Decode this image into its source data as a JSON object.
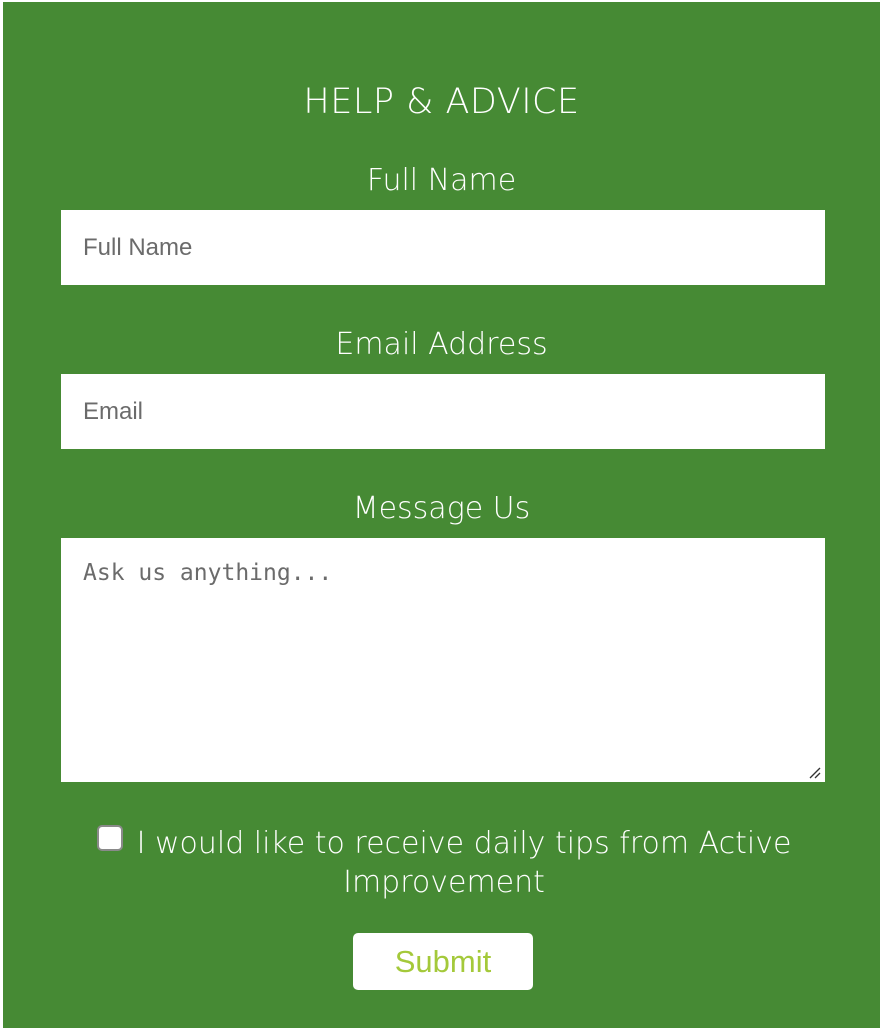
{
  "form": {
    "title": "HELP & ADVICE",
    "full_name": {
      "label": "Full Name",
      "placeholder": "Full Name",
      "value": ""
    },
    "email": {
      "label": "Email Address",
      "placeholder": "Email",
      "value": ""
    },
    "message": {
      "label": "Message Us",
      "placeholder": "Ask us anything...",
      "value": ""
    },
    "consent": {
      "label": "I would like to receive daily tips from Active Improvement",
      "checked": false
    },
    "submit_label": "Submit"
  },
  "colors": {
    "panel_background": "#468a34",
    "submit_text": "#a4c93a",
    "placeholder_text": "#6b6b6b"
  }
}
